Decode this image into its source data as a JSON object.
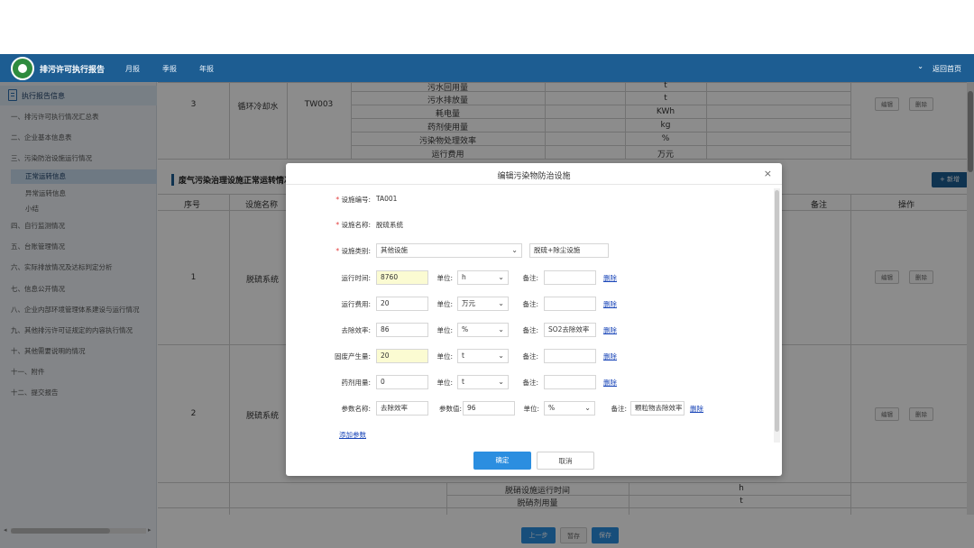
{
  "header": {
    "app_title": "排污许可执行报告",
    "nav": [
      "月报",
      "季报",
      "年报"
    ],
    "home_link": "返回首页"
  },
  "sidebar": {
    "section_title": "执行报告信息",
    "items": [
      "一、排污许可执行情况汇总表",
      "二、企业基本信息表",
      "三、污染防治设施运行情况"
    ],
    "sub_items": [
      "正常运转信息",
      "异常运转信息",
      "小结"
    ],
    "items_after": [
      "四、自行监测情况",
      "五、台账管理情况",
      "六、实际排放情况及达标判定分析",
      "七、信息公开情况",
      "八、企业内部环境管理体系建设与运行情况",
      "九、其他排污许可证规定的内容执行情况",
      "十、其他需要说明的情况",
      "十一、附件",
      "十二、提交报告"
    ]
  },
  "upper_table": {
    "row_no": "3",
    "facility_name": "循环冷却水",
    "facility_code": "TW003",
    "params": [
      "污水回用量",
      "污水排放量",
      "耗电量",
      "药剂使用量",
      "污染物处理效率",
      "运行费用"
    ],
    "units": [
      "t",
      "t",
      "KWh",
      "kg",
      "%",
      "万元"
    ],
    "edit": "编辑",
    "delete": "删除"
  },
  "section": {
    "title": "废气污染治理设施正常运转情况",
    "add_button": "+ 新增",
    "headers": [
      "序号",
      "设施名称",
      "备注",
      "操作"
    ]
  },
  "rows": [
    {
      "no": "1",
      "name": "脱硫系统",
      "edit": "编辑",
      "delete": "删除"
    },
    {
      "no": "2",
      "name": "脱硫系统",
      "edit": "编辑",
      "delete": "删除"
    }
  ],
  "bottom_params": [
    {
      "name": "脱硝设施运行时间",
      "unit": "h"
    },
    {
      "name": "脱硝剂用量",
      "unit": "t"
    }
  ],
  "bottom_buttons": {
    "prev": "上一步",
    "save_draft": "暂存",
    "save": "保存"
  },
  "dialog": {
    "title": "编辑污染物防治设施",
    "close": "×",
    "facility_code_label": "设施编号:",
    "facility_code": "TA001",
    "facility_name_label": "设施名称:",
    "facility_name": "脱硫系统",
    "category_label": "设施类别:",
    "category_value": "其他设施",
    "category_extra": "脱硫+除尘设施",
    "unit_label": "单位:",
    "remark_label": "备注:",
    "delete_link": "删除",
    "param_rows": [
      {
        "label": "运行时间:",
        "value": "8760",
        "unit": "h",
        "remark": "",
        "highlight": true
      },
      {
        "label": "运行费用:",
        "value": "20",
        "unit": "万元",
        "remark": "",
        "highlight": false
      },
      {
        "label": "去除效率:",
        "value": "86",
        "unit": "%",
        "remark": "SO2去除效率",
        "highlight": false
      },
      {
        "label": "固废产生量:",
        "value": "20",
        "unit": "t",
        "remark": "",
        "highlight": true
      },
      {
        "label": "药剂用量:",
        "value": "0",
        "unit": "t",
        "remark": "",
        "highlight": false
      }
    ],
    "custom_param": {
      "name_label": "参数名称:",
      "name": "去除效率",
      "value_label": "参数值:",
      "value": "96",
      "unit": "%",
      "remark": "颗粒物去除效率"
    },
    "add_param": "添加参数",
    "confirm": "确定",
    "cancel": "取消"
  },
  "colors": {
    "header_bg": "#1d5d92",
    "primary_button": "#2b8ee0",
    "highlight_input": "#fbfbd2"
  }
}
